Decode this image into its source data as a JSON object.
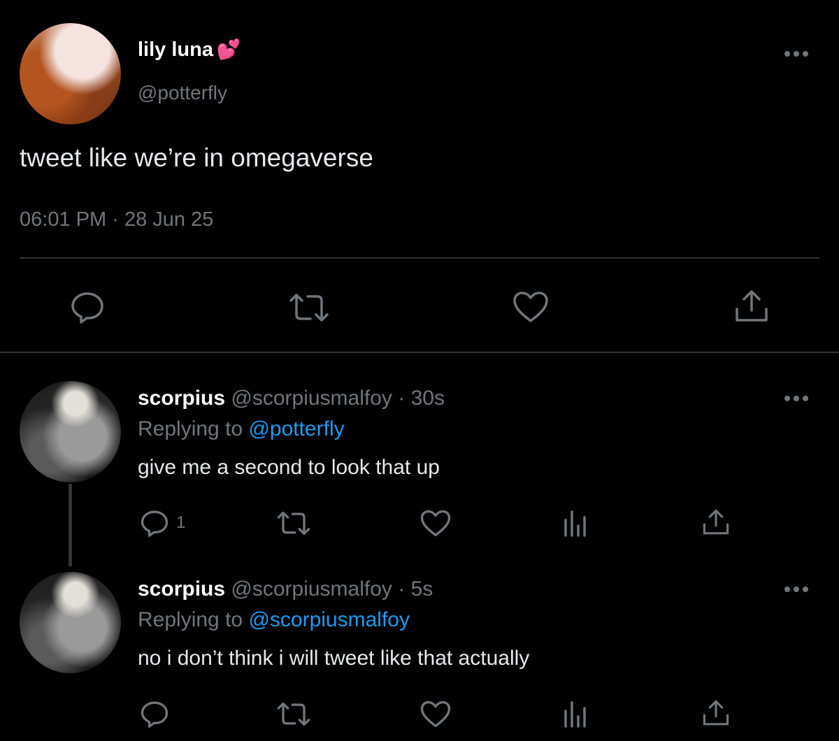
{
  "main_tweet": {
    "display_name": "lily luna",
    "name_emoji": "💕",
    "handle": "@potterfly",
    "text": "tweet like we’re in omegaverse",
    "time": "06:01 PM",
    "separator": "·",
    "date": "28 Jun 25",
    "actions": [
      "reply-icon",
      "retweet-icon",
      "like-icon",
      "share-icon"
    ]
  },
  "replies": [
    {
      "display_name": "scorpius",
      "handle": "@scorpiusmalfoy",
      "separator": "·",
      "time_ago": "30s",
      "replying_label": "Replying to",
      "replying_to": "@potterfly",
      "text": "give me a second to look that up",
      "reply_count": "1",
      "actions": [
        "reply-icon",
        "retweet-icon",
        "like-icon",
        "analytics-icon",
        "share-icon"
      ]
    },
    {
      "display_name": "scorpius",
      "handle": "@scorpiusmalfoy",
      "separator": "·",
      "time_ago": "5s",
      "replying_label": "Replying to",
      "replying_to": "@scorpiusmalfoy",
      "text": "no i don’t think i will tweet like that actually",
      "actions": [
        "reply-icon",
        "retweet-icon",
        "like-icon",
        "analytics-icon",
        "share-icon"
      ]
    }
  ],
  "colors": {
    "background": "#000000",
    "text": "#e7e9ea",
    "muted": "#71767b",
    "link": "#1d9bf0",
    "divider": "#2f3336"
  }
}
